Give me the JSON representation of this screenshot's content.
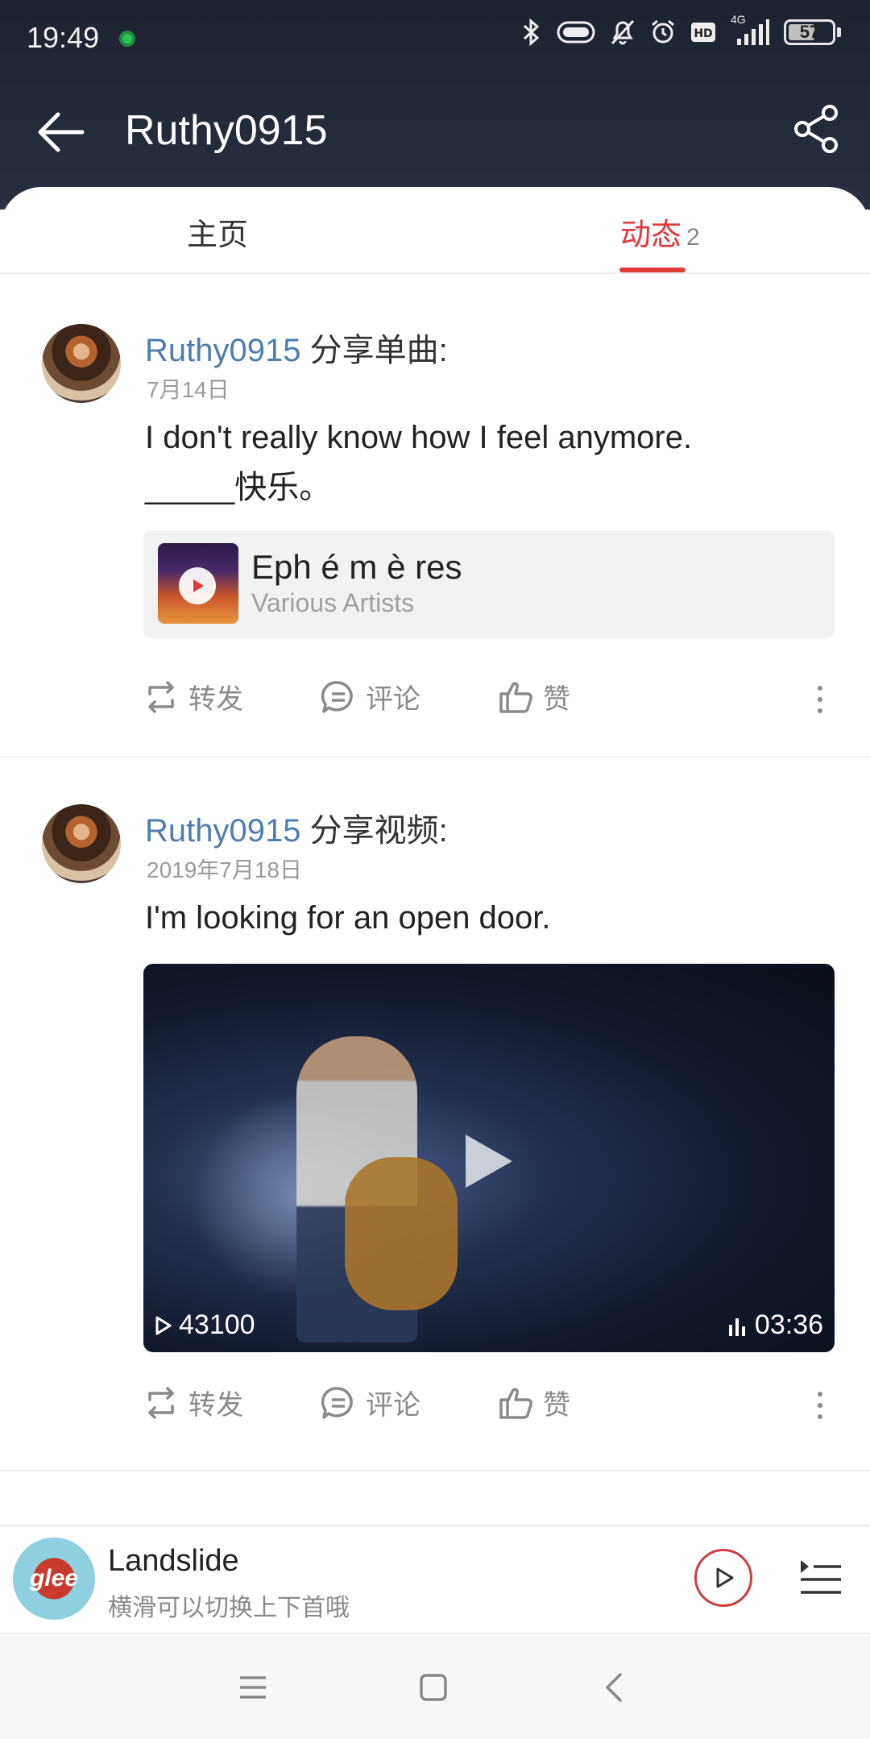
{
  "status_bar": {
    "time": "19:49",
    "network": "4G",
    "battery": "57"
  },
  "header": {
    "title": "Ruthy0915"
  },
  "tabs": {
    "home_label": "主页",
    "activity_label": "动态",
    "activity_count": "2"
  },
  "posts": [
    {
      "user": "Ruthy0915",
      "action": "分享单曲:",
      "date": "7月14日",
      "text_line1": "I don't really know how I feel anymore.",
      "text_line2": "_____快乐。",
      "song": {
        "title": "Eph é m è res",
        "artist": "Various Artists"
      },
      "actions": {
        "repost": "转发",
        "comment": "评论",
        "like": "赞"
      }
    },
    {
      "user": "Ruthy0915",
      "action": "分享视频:",
      "date": "2019年7月18日",
      "text_line1": "I'm looking for an open door.",
      "video": {
        "views": "43100",
        "duration": "03:36"
      },
      "actions": {
        "repost": "转发",
        "comment": "评论",
        "like": "赞"
      }
    }
  ],
  "player": {
    "title": "Landslide",
    "hint": "横滑可以切换上下首哦",
    "cover_text": "glee"
  },
  "colors": {
    "accent": "#e0393b",
    "username": "#507daf",
    "header_bg": "#1c2230"
  }
}
